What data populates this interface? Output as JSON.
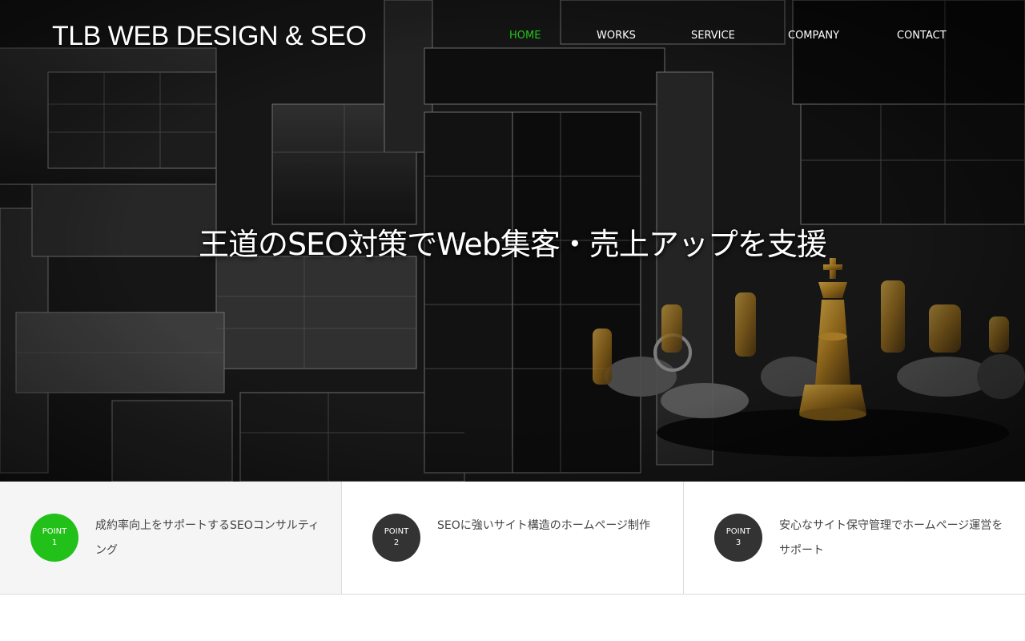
{
  "header": {
    "logo": "TLB WEB DESIGN & SEO",
    "nav": [
      {
        "label": "HOME",
        "active": true
      },
      {
        "label": "WORKS",
        "active": false
      },
      {
        "label": "SERVICE",
        "active": false
      },
      {
        "label": "COMPANY",
        "active": false
      },
      {
        "label": "CONTACT",
        "active": false
      }
    ]
  },
  "hero": {
    "title": "王道のSEO対策でWeb集客・売上アップを支援"
  },
  "points": [
    {
      "badge_word": "POINT",
      "badge_num": "1",
      "text": "成約率向上をサポートするSEOコンサルティング"
    },
    {
      "badge_word": "POINT",
      "badge_num": "2",
      "text": "SEOに強いサイト構造のホームページ制作"
    },
    {
      "badge_word": "POINT",
      "badge_num": "3",
      "text": "安心なサイト保守管理でホームページ運営をサポート"
    }
  ],
  "colors": {
    "accent_green": "#21c11a",
    "badge_dark": "#333333"
  }
}
